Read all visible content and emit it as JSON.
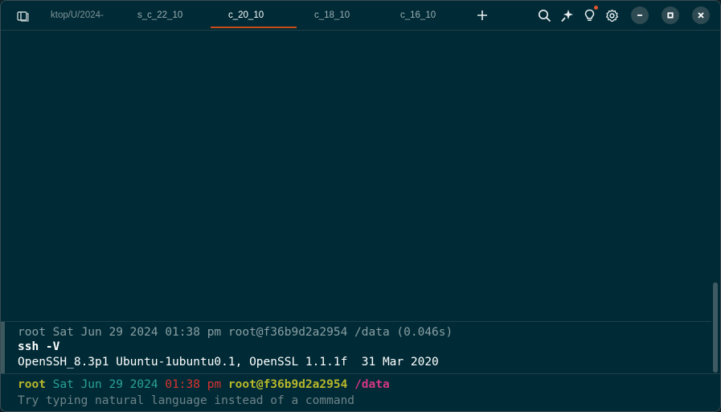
{
  "tabs": [
    {
      "label": "ktop/U/2024-",
      "active": false
    },
    {
      "label": "s_c_22_10",
      "active": false
    },
    {
      "label": "c_20_10",
      "active": true
    },
    {
      "label": "c_18_10",
      "active": false
    },
    {
      "label": "c_16_10",
      "active": false
    }
  ],
  "icons": {
    "tab_panel": "tab-panel-icon",
    "new_tab": "plus-icon",
    "search": "search-icon",
    "ai": "sparkle-icon",
    "tips": "lightbulb-icon",
    "settings": "gear-icon",
    "minimize": "minimize-icon",
    "maximize": "maximize-icon",
    "close": "close-icon"
  },
  "colors": {
    "background": "#002b36",
    "active_tab_underline": "#cb4b16",
    "notification_dot": "#e0562b"
  },
  "block": {
    "header": "root Sat Jun 29 2024 01:38 pm root@f36b9d2a2954 /data (0.046s)",
    "command": "ssh -V",
    "output": "OpenSSH_8.3p1 Ubuntu-1ubuntu0.1, OpenSSL 1.1.1f  31 Mar 2020"
  },
  "prompt": {
    "user": "root",
    "date": "Sat Jun 29 2024",
    "time": "01:38 pm",
    "host": "root@f36b9d2a2954",
    "dir": "/data"
  },
  "input": {
    "placeholder": "Try typing natural language instead of a command"
  }
}
